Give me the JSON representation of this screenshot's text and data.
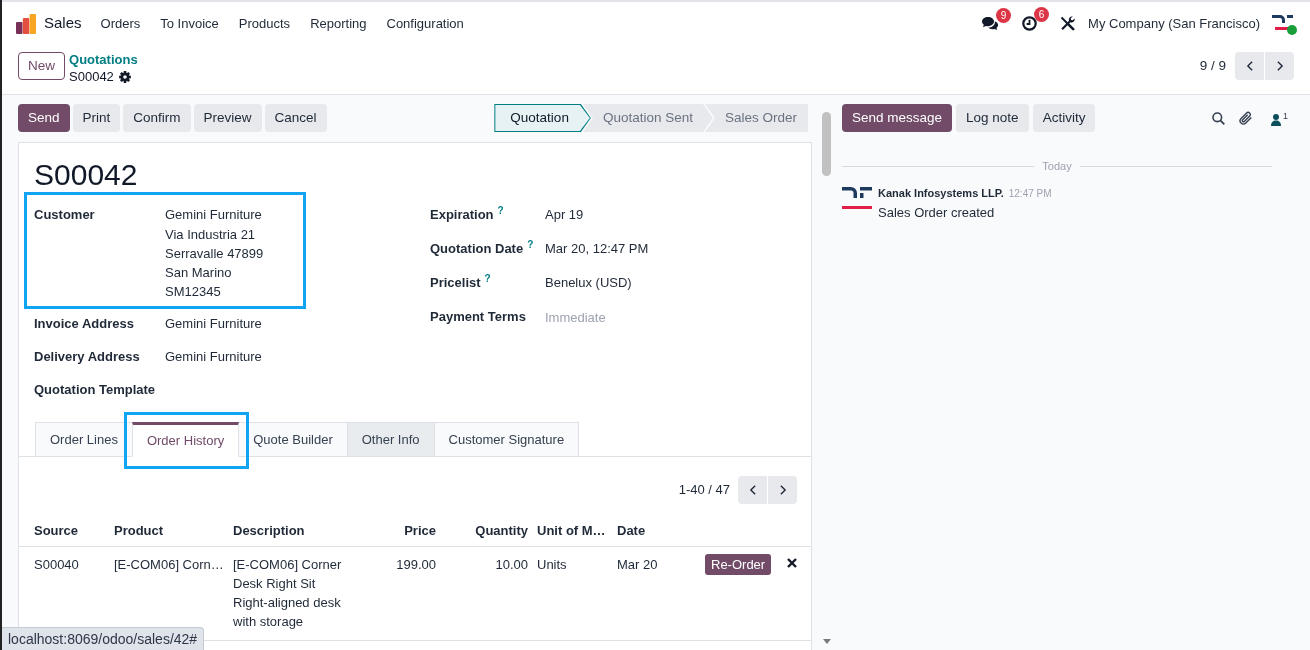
{
  "navbar": {
    "app_name": "Sales",
    "menu": [
      "Orders",
      "To Invoice",
      "Products",
      "Reporting",
      "Configuration"
    ],
    "systray": [
      {
        "kind": "messages",
        "badge": "9"
      },
      {
        "kind": "activities",
        "badge": "6"
      },
      {
        "kind": "debug"
      }
    ],
    "company": "My Company (San Francisco)",
    "user_online": true
  },
  "control_panel": {
    "new_button": "New",
    "breadcrumb_parent": "Quotations",
    "record_name": "S00042",
    "pager": "9 / 9"
  },
  "action_buttons": [
    {
      "label": "Send",
      "primary": true
    },
    {
      "label": "Print",
      "primary": false
    },
    {
      "label": "Confirm",
      "primary": false
    },
    {
      "label": "Preview",
      "primary": false
    },
    {
      "label": "Cancel",
      "primary": false
    }
  ],
  "statusbar": [
    {
      "label": "Quotation",
      "selected": true
    },
    {
      "label": "Quotation Sent",
      "selected": false
    },
    {
      "label": "Sales Order",
      "selected": false
    }
  ],
  "form": {
    "title": "S00042",
    "left_fields": [
      {
        "label": "Customer",
        "value": "Gemini Furniture",
        "address": [
          "Via Industria 21",
          "Serravalle 47899",
          "San Marino",
          "SM12345"
        ],
        "highlighted": true
      },
      {
        "label": "Invoice Address",
        "value": "Gemini Furniture",
        "highlighted": false
      },
      {
        "label": "Delivery Address",
        "value": "Gemini Furniture",
        "highlighted": false
      },
      {
        "label": "Quotation Template",
        "highlighted": false
      }
    ],
    "right_fields": [
      {
        "label": "Expiration",
        "help": "?",
        "value": "Apr 19"
      },
      {
        "label": "Quotation Date",
        "help": "?",
        "value": "Mar 20, 12:47 PM"
      },
      {
        "label": "Pricelist",
        "help": "?",
        "value": "Benelux (USD)"
      },
      {
        "label": "Payment Terms",
        "placeholder": "Immediate"
      }
    ]
  },
  "notebook": {
    "tabs": [
      {
        "label": "Order Lines",
        "selected": false,
        "hovered": false,
        "highlighted": false
      },
      {
        "label": "Order History",
        "selected": true,
        "hovered": false,
        "highlighted": true
      },
      {
        "label": "Quote Builder",
        "selected": false,
        "hovered": false,
        "highlighted": false
      },
      {
        "label": "Other Info",
        "selected": false,
        "hovered": true,
        "highlighted": false
      },
      {
        "label": "Customer Signature",
        "selected": false,
        "hovered": false,
        "highlighted": false
      }
    ],
    "pager": "1-40 / 47",
    "table": {
      "columns": [
        {
          "label": "Source",
          "kind": "text"
        },
        {
          "label": "Product",
          "kind": "text"
        },
        {
          "label": "Description",
          "kind": "text"
        },
        {
          "label": "Price",
          "kind": "number"
        },
        {
          "label": "Quantity",
          "kind": "number"
        },
        {
          "label": "Unit of M…",
          "kind": "text"
        },
        {
          "label": "Date",
          "kind": "text"
        }
      ],
      "rows": [
        {
          "cells": [
            "S00040",
            "[E-COM06] Corn…",
            "[E-COM06] Corner Desk Right Sit\nRight-aligned desk with storage",
            "199.00",
            "10.00",
            "Units",
            "Mar 20"
          ],
          "action": "Re-Order"
        }
      ]
    }
  },
  "chatter": {
    "buttons": [
      {
        "label": "Send message",
        "primary": true
      },
      {
        "label": "Log note",
        "primary": false
      },
      {
        "label": "Activity",
        "primary": false
      }
    ],
    "followers": "1",
    "separator": "Today",
    "messages": [
      {
        "author": "Kanak Infosystems LLP.",
        "time": "12:47 PM",
        "body": "Sales Order created"
      }
    ]
  },
  "browser_status": "localhost:8069/odoo/sales/42#"
}
